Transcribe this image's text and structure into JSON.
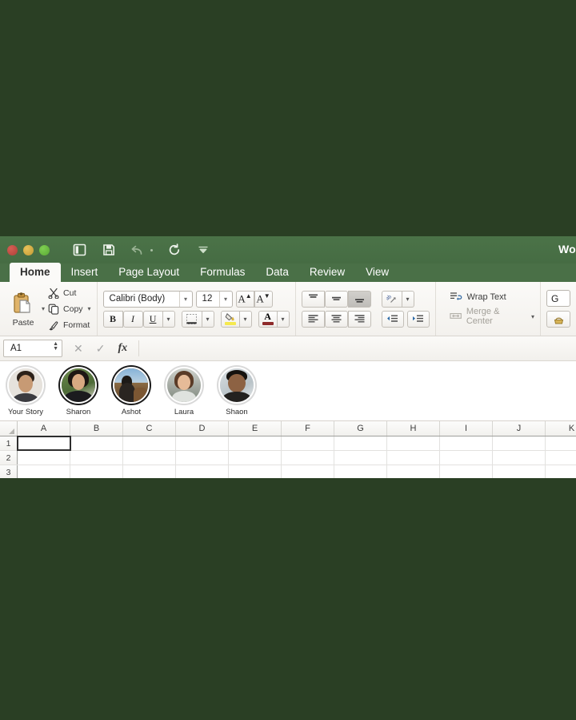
{
  "desktop": {
    "background_color": "#2a3f24"
  },
  "window": {
    "title": "Wor",
    "chrome_color": "#4a7047",
    "traffic_lights": [
      {
        "name": "close",
        "color": "#c9524a"
      },
      {
        "name": "minimize",
        "color": "#dbb342"
      },
      {
        "name": "maximize",
        "color": "#6fc348"
      }
    ],
    "quick_access": [
      {
        "icon": "sidebar-icon",
        "label": "Sidebar"
      },
      {
        "icon": "save-icon",
        "label": "Save"
      },
      {
        "icon": "undo-icon",
        "label": "Undo"
      },
      {
        "icon": "redo-icon",
        "label": "Redo"
      },
      {
        "icon": "chevron-down-icon",
        "label": "Customize Toolbar"
      }
    ]
  },
  "ribbon": {
    "tabs": [
      {
        "label": "Home",
        "active": true
      },
      {
        "label": "Insert",
        "active": false
      },
      {
        "label": "Page Layout",
        "active": false
      },
      {
        "label": "Formulas",
        "active": false
      },
      {
        "label": "Data",
        "active": false
      },
      {
        "label": "Review",
        "active": false
      },
      {
        "label": "View",
        "active": false
      }
    ],
    "clipboard": {
      "paste_label": "Paste",
      "cut_label": "Cut",
      "copy_label": "Copy",
      "format_label": "Format"
    },
    "font": {
      "family_value": "Calibri (Body)",
      "size_value": "12",
      "grow_label": "A",
      "shrink_label": "A",
      "bold_label": "B",
      "italic_label": "I",
      "underline_label": "U",
      "borders_label": "Borders",
      "fill_color": "#f5e94e",
      "font_color": "#8e2a2a"
    },
    "alignment": {
      "top_align_label": "Top Align",
      "middle_align_label": "Middle Align",
      "bottom_align_label": "Bottom Align",
      "bottom_align_active": true,
      "orientation_label": "Orientation",
      "align_left_label": "Align Left",
      "align_center_label": "Center",
      "align_right_label": "Align Right",
      "decrease_indent_label": "Decrease Indent",
      "increase_indent_label": "Increase Indent",
      "wrap_text_label": "Wrap Text",
      "merge_center_label": "Merge & Center"
    },
    "number": {
      "format_value": "G"
    }
  },
  "formula_bar": {
    "name_box_value": "A1",
    "cancel_label": "✕",
    "enter_label": "✓",
    "function_label": "fx",
    "formula_value": ""
  },
  "stories": [
    {
      "name": "Your Story",
      "ring": "seen"
    },
    {
      "name": "Sharon",
      "ring": "unseen"
    },
    {
      "name": "Ashot",
      "ring": "unseen"
    },
    {
      "name": "Laura",
      "ring": "seen"
    },
    {
      "name": "Shaon",
      "ring": "seen"
    }
  ],
  "sheet": {
    "columns": [
      "A",
      "B",
      "C",
      "D",
      "E",
      "F",
      "G",
      "H",
      "I",
      "J",
      "K"
    ],
    "rows": [
      "1",
      "2",
      "3"
    ],
    "selected_cell": "A1",
    "cells": [
      [
        "",
        "",
        "",
        "",
        "",
        "",
        "",
        "",
        "",
        "",
        ""
      ],
      [
        "",
        "",
        "",
        "",
        "",
        "",
        "",
        "",
        "",
        "",
        ""
      ],
      [
        "",
        "",
        "",
        "",
        "",
        "",
        "",
        "",
        "",
        "",
        ""
      ]
    ]
  }
}
